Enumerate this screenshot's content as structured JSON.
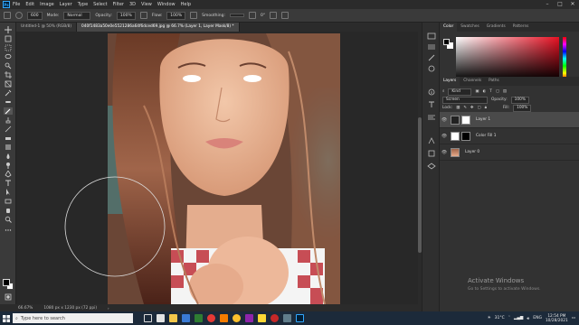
{
  "menubar": {
    "logo": "Ps",
    "items": [
      "File",
      "Edit",
      "Image",
      "Layer",
      "Type",
      "Select",
      "Filter",
      "3D",
      "View",
      "Window",
      "Help"
    ]
  },
  "optionsbar": {
    "brush_size": "600",
    "mode_label": "Mode:",
    "mode_value": "Normal",
    "opacity_label": "Opacity:",
    "opacity_value": "100%",
    "flow_label": "Flow:",
    "flow_value": "100%",
    "smoothing_label": "Smoothing:",
    "angle_value": "0°"
  },
  "tabs": [
    {
      "label": "Untitled-1 @ 50% (RGB/8)",
      "active": false
    },
    {
      "label": "040f1483a50e0e5521286a64f6dced69.jpg @ 66.7% (Layer 1, Layer Mask/8) *",
      "active": true
    }
  ],
  "statusbar": {
    "zoom": "66.67%",
    "doc_size": "1080 px x 1230 px (72 ppi)"
  },
  "color_panel": {
    "tabs": [
      "Color",
      "Swatches",
      "Gradients",
      "Patterns"
    ]
  },
  "layers_panel": {
    "tabs": [
      "Layers",
      "Channels",
      "Paths"
    ],
    "filter_label": "Kind",
    "blend_mode": "Screen",
    "opacity_label": "Opacity:",
    "opacity_value": "100%",
    "lock_label": "Lock:",
    "fill_label": "Fill:",
    "fill_value": "100%",
    "layers": [
      {
        "name": "Layer 1",
        "selected": true
      },
      {
        "name": "Color Fill 1",
        "selected": false
      },
      {
        "name": "Layer 0",
        "selected": false
      }
    ]
  },
  "watermark": {
    "title": "Activate Windows",
    "subtitle": "Go to Settings to activate Windows."
  },
  "taskbar": {
    "search_placeholder": "Type here to search",
    "temperature": "31°C",
    "language": "ENG",
    "time": "12:54 PM",
    "date": "10/28/2021"
  },
  "colors": {
    "accent_blue": "#31a8ff",
    "ps_dark": "#001e36",
    "picker_red": "#e81123"
  }
}
